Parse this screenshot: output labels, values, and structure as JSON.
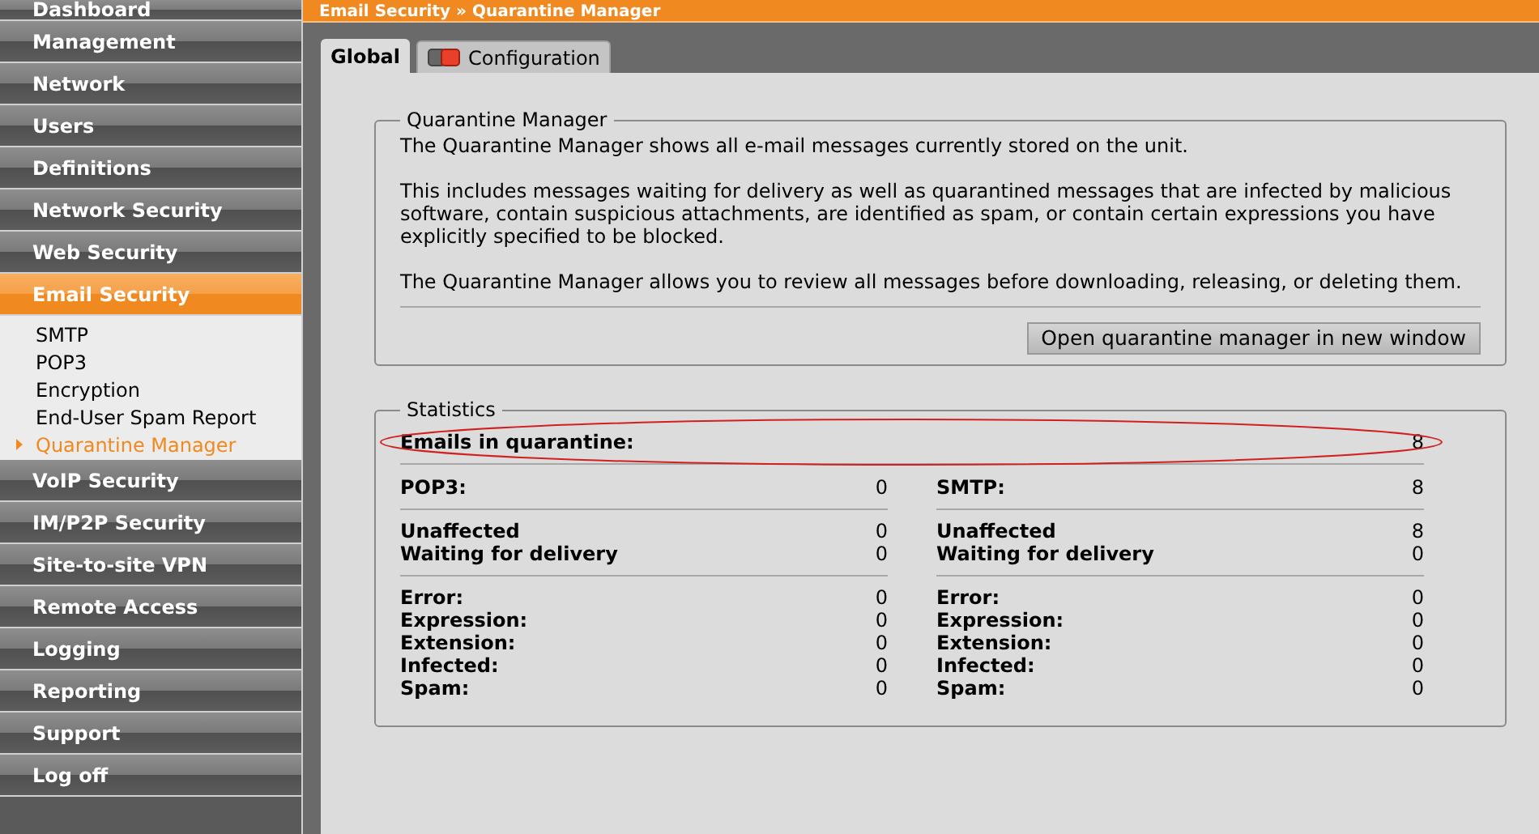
{
  "breadcrumb": "Email Security » Quarantine Manager",
  "sidebar": {
    "items": [
      {
        "label": "Dashboard",
        "selected": false
      },
      {
        "label": "Management",
        "selected": false
      },
      {
        "label": "Network",
        "selected": false
      },
      {
        "label": "Users",
        "selected": false
      },
      {
        "label": "Definitions",
        "selected": false
      },
      {
        "label": "Network Security",
        "selected": false
      },
      {
        "label": "Web Security",
        "selected": false
      },
      {
        "label": "Email Security",
        "selected": true,
        "children": [
          {
            "label": "SMTP",
            "selected": false
          },
          {
            "label": "POP3",
            "selected": false
          },
          {
            "label": "Encryption",
            "selected": false
          },
          {
            "label": "End-User Spam Report",
            "selected": false
          },
          {
            "label": "Quarantine Manager",
            "selected": true
          }
        ]
      },
      {
        "label": "VoIP Security",
        "selected": false
      },
      {
        "label": "IM/P2P Security",
        "selected": false
      },
      {
        "label": "Site-to-site VPN",
        "selected": false
      },
      {
        "label": "Remote Access",
        "selected": false
      },
      {
        "label": "Logging",
        "selected": false
      },
      {
        "label": "Reporting",
        "selected": false
      },
      {
        "label": "Support",
        "selected": false
      },
      {
        "label": "Log off",
        "selected": false
      }
    ]
  },
  "tabs": [
    {
      "label": "Global",
      "selected": true,
      "icon": false
    },
    {
      "label": "Configuration",
      "selected": false,
      "icon": true
    }
  ],
  "quarantine_manager": {
    "title": "Quarantine Manager",
    "paragraphs": [
      "The Quarantine Manager shows all e-mail messages currently stored on the unit.",
      "This includes messages waiting for delivery as well as quarantined messages that are infected by malicious software, contain suspicious attachments, are identified as spam, or contain certain expressions you have explicitly specified to be blocked.",
      "The Quarantine Manager allows you to review all messages before downloading, releasing, or deleting them."
    ],
    "button": "Open quarantine manager in new window"
  },
  "statistics": {
    "title": "Statistics",
    "total": {
      "label": "Emails in quarantine:",
      "value": "8",
      "highlighted": true
    },
    "columns": [
      {
        "groups": [
          [
            {
              "label": "POP3:",
              "value": "0"
            }
          ],
          [
            {
              "label": "Unaffected",
              "value": "0"
            },
            {
              "label": "Waiting for delivery",
              "value": "0"
            }
          ],
          [
            {
              "label": "Error:",
              "value": "0"
            },
            {
              "label": "Expression:",
              "value": "0"
            },
            {
              "label": "Extension:",
              "value": "0"
            },
            {
              "label": "Infected:",
              "value": "0"
            },
            {
              "label": "Spam:",
              "value": "0"
            }
          ]
        ]
      },
      {
        "groups": [
          [
            {
              "label": "SMTP:",
              "value": "8"
            }
          ],
          [
            {
              "label": "Unaffected",
              "value": "8"
            },
            {
              "label": "Waiting for delivery",
              "value": "0"
            }
          ],
          [
            {
              "label": "Error:",
              "value": "0"
            },
            {
              "label": "Expression:",
              "value": "0"
            },
            {
              "label": "Extension:",
              "value": "0"
            },
            {
              "label": "Infected:",
              "value": "0"
            },
            {
              "label": "Spam:",
              "value": "0"
            }
          ]
        ]
      }
    ]
  }
}
